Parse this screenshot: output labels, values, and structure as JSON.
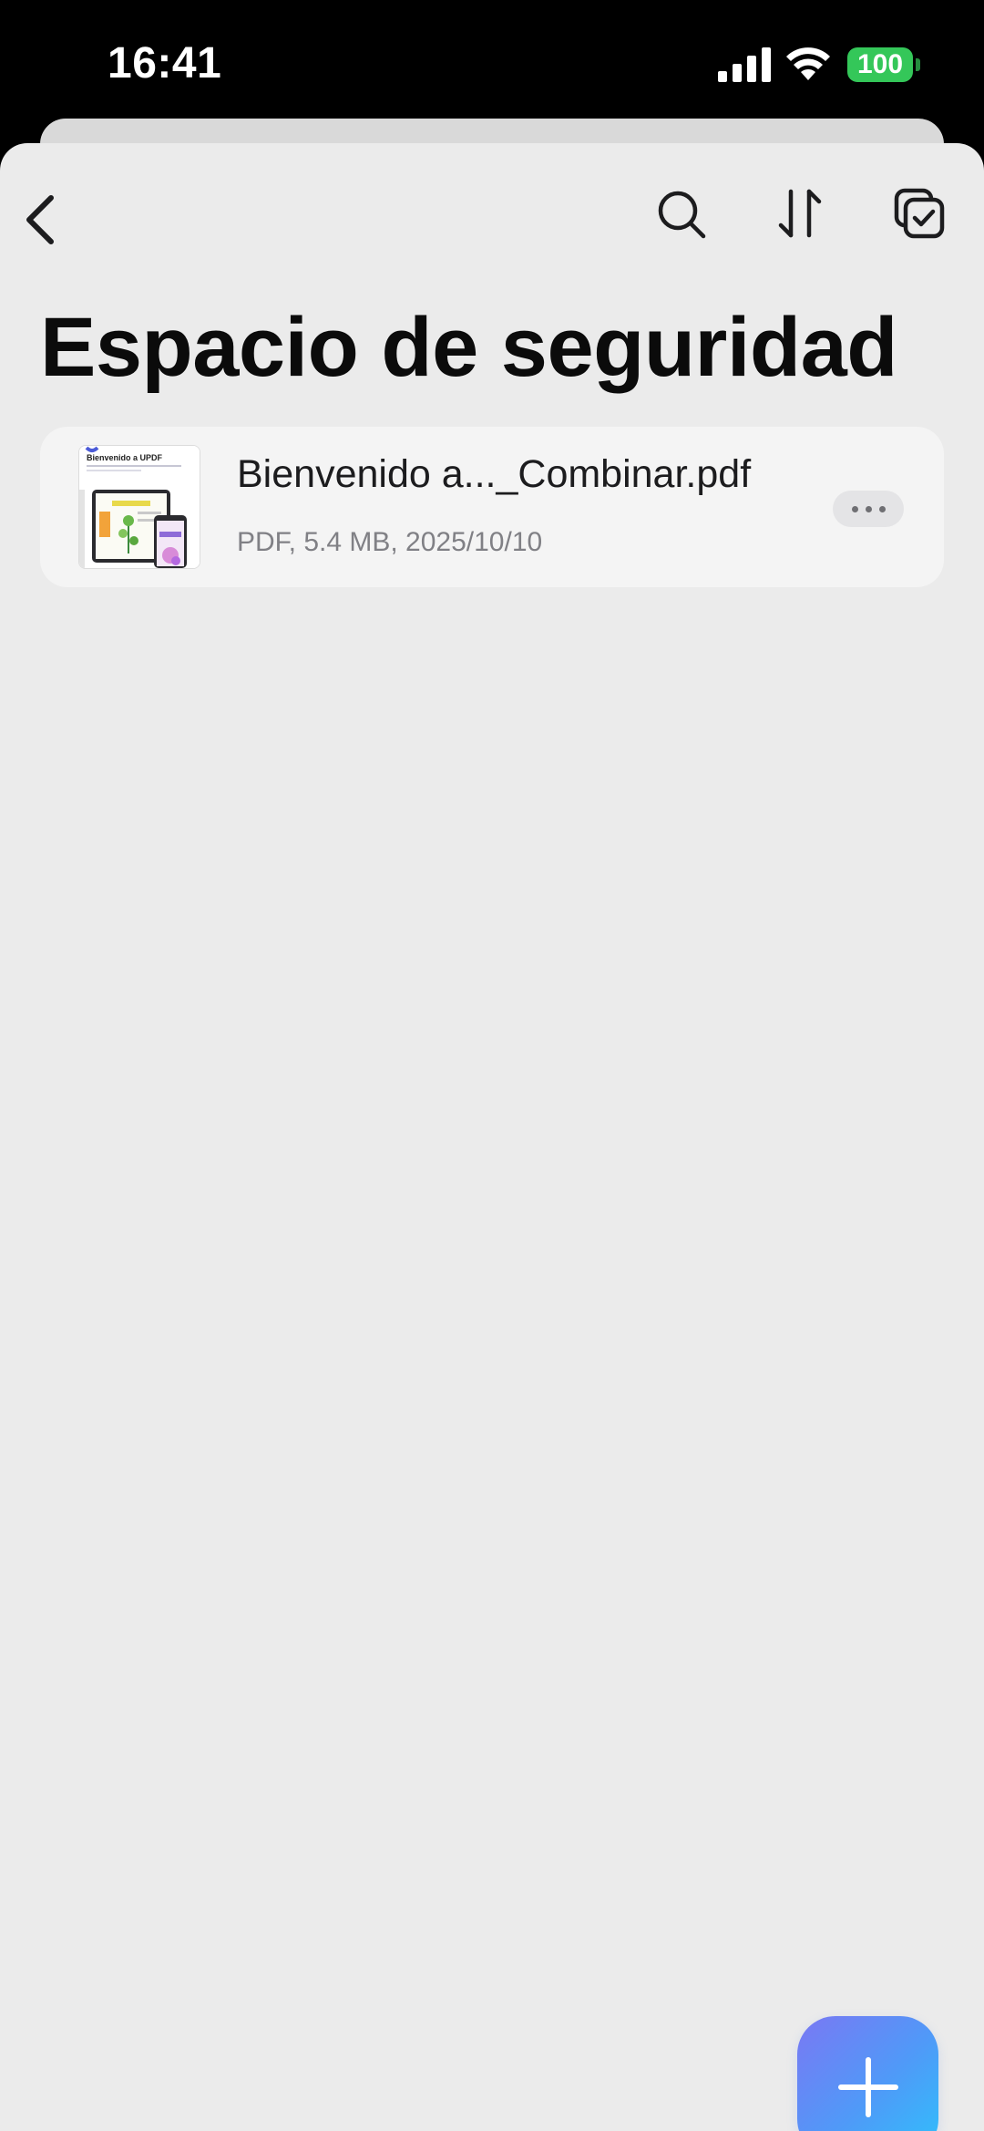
{
  "status_bar": {
    "time": "16:41",
    "battery": "100",
    "battery_color": "#34c759"
  },
  "nav": {
    "back_icon": "chevron-left-icon",
    "search_icon": "search-icon",
    "sort_icon": "sort-arrows-icon",
    "select_icon": "multi-select-icon"
  },
  "page": {
    "title": "Espacio de seguridad"
  },
  "files": [
    {
      "name": "Bienvenido a..._Combinar.pdf",
      "meta": "PDF, 5.4 MB, 2025/10/10",
      "thumbnail": {
        "heading": "Bienvenido a UPDF"
      }
    }
  ],
  "fab": {
    "icon": "plus-icon",
    "accent_start": "#7a78f3",
    "accent_end": "#2fc0fb"
  }
}
